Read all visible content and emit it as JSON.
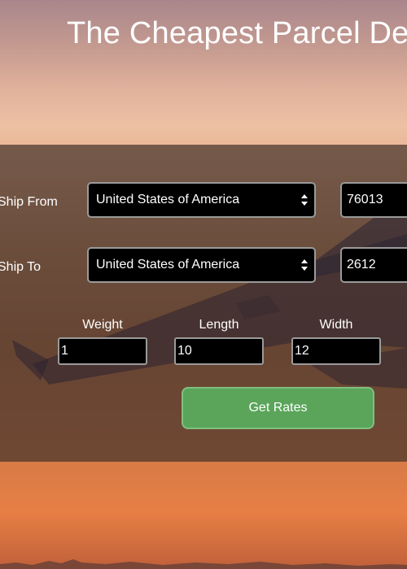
{
  "hero": {
    "title": "The Cheapest Parcel De"
  },
  "form": {
    "ship_from": {
      "label": "Ship From",
      "country": "United States of America",
      "postcode": "76013"
    },
    "ship_to": {
      "label": "Ship To",
      "country": "United States of America",
      "postcode": "2612"
    },
    "weight": {
      "label": "Weight",
      "value": "1"
    },
    "length": {
      "label": "Length",
      "value": "10"
    },
    "width": {
      "label": "Width",
      "value": "12"
    },
    "submit_label": "Get Rates"
  },
  "colors": {
    "button": "#5aa55a",
    "panel": "#46342c",
    "input_bg": "#000000"
  },
  "icons": [
    "select-arrows-icon"
  ]
}
